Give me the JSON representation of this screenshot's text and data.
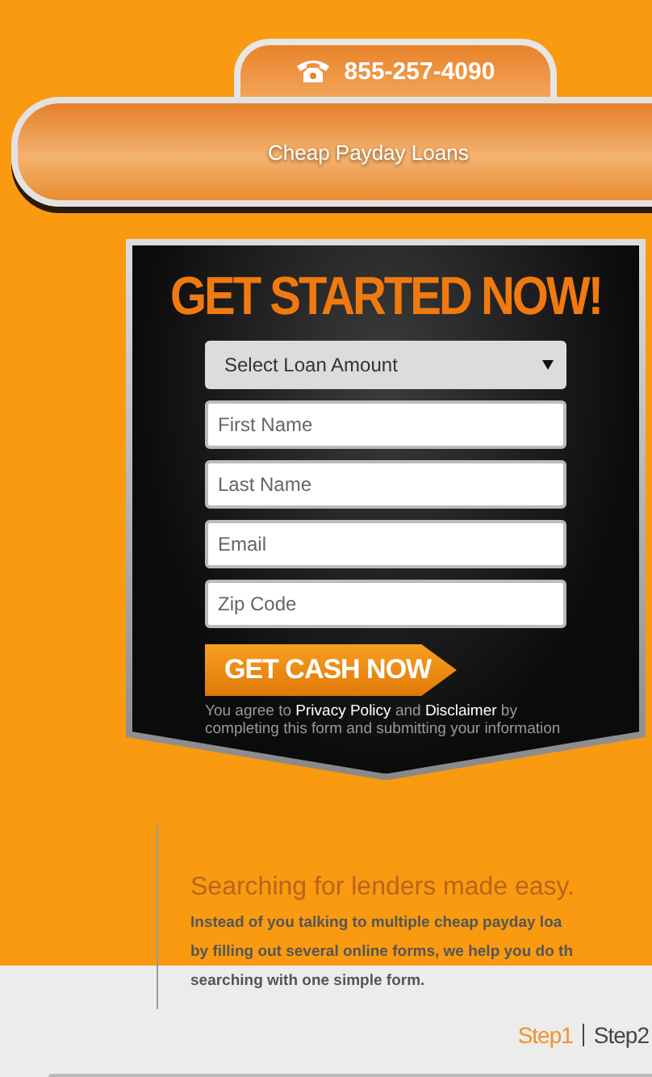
{
  "phone": {
    "number": "855-257-4090"
  },
  "banner": {
    "title": "Cheap Payday Loans"
  },
  "form": {
    "heading": "GET STARTED NOW!",
    "loan_select": {
      "placeholder": "Select Loan Amount"
    },
    "fields": [
      {
        "placeholder": "First Name"
      },
      {
        "placeholder": "Last Name"
      },
      {
        "placeholder": "Email"
      },
      {
        "placeholder": "Zip Code"
      }
    ],
    "submit": "GET CASH NOW",
    "agreement": {
      "before": "You agree to",
      "link_1": "Privacy Policy",
      "middle": "and",
      "link_2": "Disclaimer",
      "after": "by completing this form and submitting your information"
    }
  },
  "info": {
    "heading": "Searching for lenders made easy.",
    "lines": [
      "Instead of you talking to multiple cheap payday loa",
      "by filling out several online forms, we help you do th",
      "searching with one simple form."
    ]
  },
  "steps": [
    {
      "label": "Step1",
      "selected": true
    },
    {
      "label": "Step2",
      "selected": false
    }
  ]
}
